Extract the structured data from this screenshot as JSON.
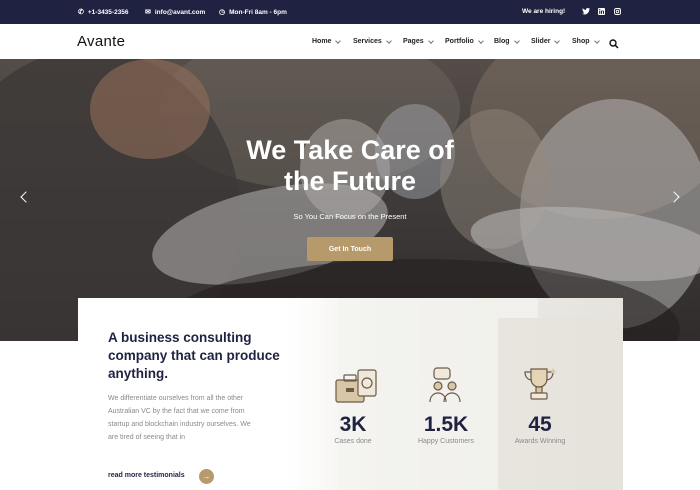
{
  "topbar": {
    "phone": "+1-3435-2356",
    "email": "info@avant.com",
    "hours": "Mon-Fri 8am - 6pm",
    "hiring": "We are hiring!",
    "phone_icon": "phone-icon",
    "email_icon": "envelope-icon",
    "hours_icon": "clock-icon",
    "social": [
      "twitter-icon",
      "linkedin-icon",
      "instagram-icon"
    ]
  },
  "nav": {
    "logo": "Avante",
    "items": [
      {
        "label": "Home"
      },
      {
        "label": "Services"
      },
      {
        "label": "Pages"
      },
      {
        "label": "Portfolio"
      },
      {
        "label": "Blog"
      },
      {
        "label": "Slider"
      },
      {
        "label": "Shop"
      }
    ],
    "search_icon": "search-icon"
  },
  "hero": {
    "title_line1": "We Take Care of",
    "title_line2": "the Future",
    "subtitle": "So You Can Focus on the Present",
    "button": "Get In Touch"
  },
  "card": {
    "heading": "A business consulting company that can produce anything.",
    "text": "We differentiate ourselves from all the other Australian VC by the fact that we come from startup and blockchain industry ourselves. We are tired of seeing that in",
    "link": "read more testimonials",
    "stats": [
      {
        "value": "3K",
        "label": "Cases done",
        "icon": "briefcase-icon"
      },
      {
        "value": "1.5K",
        "label": "Happy Customers",
        "icon": "customers-icon"
      },
      {
        "value": "45",
        "label": "Awards Winning",
        "icon": "trophy-icon"
      }
    ]
  },
  "colors": {
    "navy": "#1f2341",
    "accent": "#b79a6b",
    "muted_text": "#8a8a8a"
  }
}
